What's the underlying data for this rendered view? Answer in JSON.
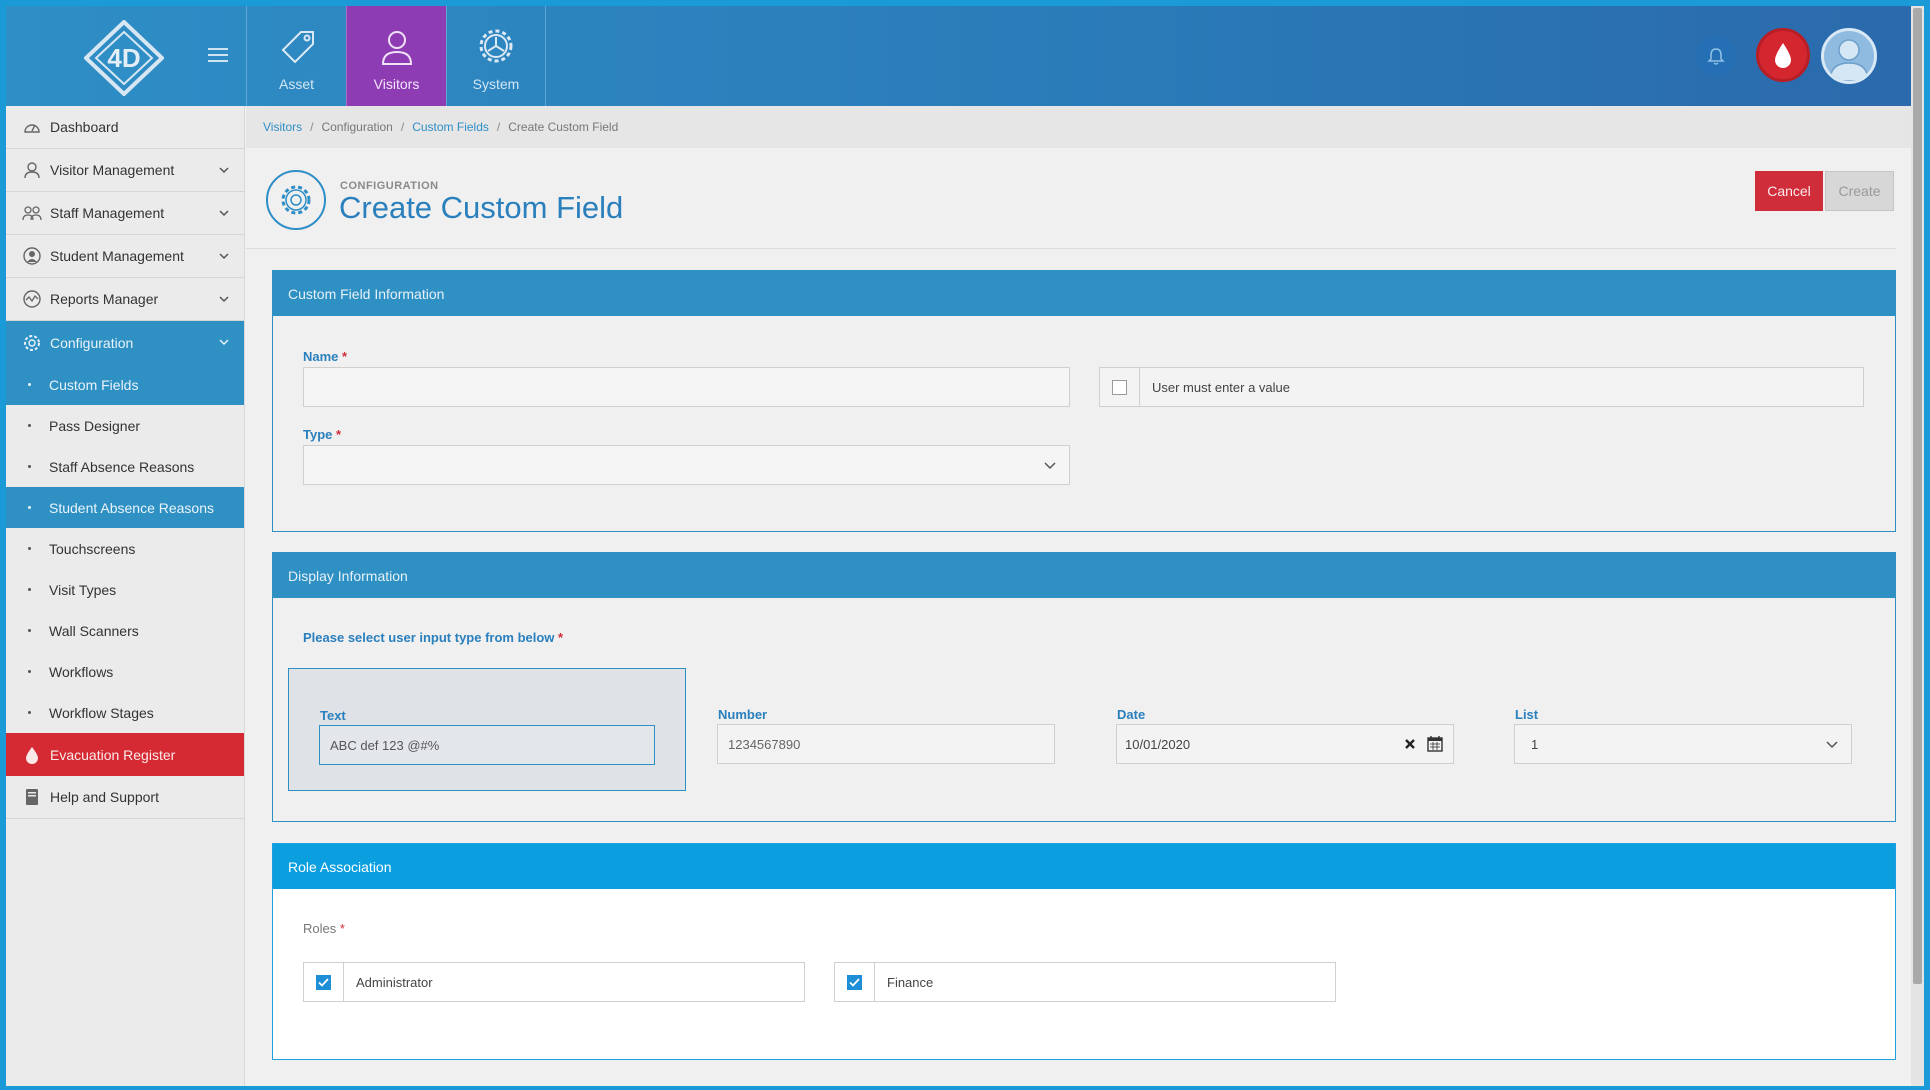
{
  "topbar": {
    "apps": [
      {
        "label": "Asset",
        "icon": "tag-icon"
      },
      {
        "label": "Visitors",
        "icon": "person-icon"
      },
      {
        "label": "System",
        "icon": "gear-icon"
      }
    ]
  },
  "sidebar": {
    "items": [
      {
        "label": "Dashboard",
        "icon": "dashboard-icon"
      },
      {
        "label": "Visitor Management",
        "icon": "visitor-icon"
      },
      {
        "label": "Staff Management",
        "icon": "staff-icon"
      },
      {
        "label": "Student Management",
        "icon": "student-icon"
      },
      {
        "label": "Reports Manager",
        "icon": "reports-icon"
      },
      {
        "label": "Configuration",
        "icon": "gear-icon"
      }
    ],
    "subitems": [
      "Custom Fields",
      "Pass Designer",
      "Staff Absence Reasons",
      "Student Absence Reasons",
      "Touchscreens",
      "Visit Types",
      "Wall Scanners",
      "Workflows",
      "Workflow Stages"
    ],
    "evacuation": "Evacuation Register",
    "help": "Help and Support"
  },
  "breadcrumb": [
    "Visitors",
    "Configuration",
    "Custom Fields",
    "Create Custom Field"
  ],
  "header": {
    "subtitle": "CONFIGURATION",
    "title": "Create Custom Field",
    "cancel": "Cancel",
    "create": "Create"
  },
  "info_panel": {
    "title": "Custom Field Information",
    "name_label": "Name",
    "name_value": "",
    "required_label": "User must enter a value",
    "type_label": "Type",
    "type_value": "",
    "required_mark": "*"
  },
  "display_panel": {
    "title": "Display Information",
    "prompt": "Please select user input type from below",
    "text_label": "Text",
    "text_value": "ABC def 123 @#%",
    "number_label": "Number",
    "number_value": "1234567890",
    "date_label": "Date",
    "date_value": "10/01/2020",
    "list_label": "List",
    "list_value": "1"
  },
  "role_panel": {
    "title": "Role Association",
    "roles_label": "Roles",
    "roles": [
      {
        "label": "Administrator",
        "checked": true
      },
      {
        "label": "Finance",
        "checked": true
      }
    ]
  }
}
